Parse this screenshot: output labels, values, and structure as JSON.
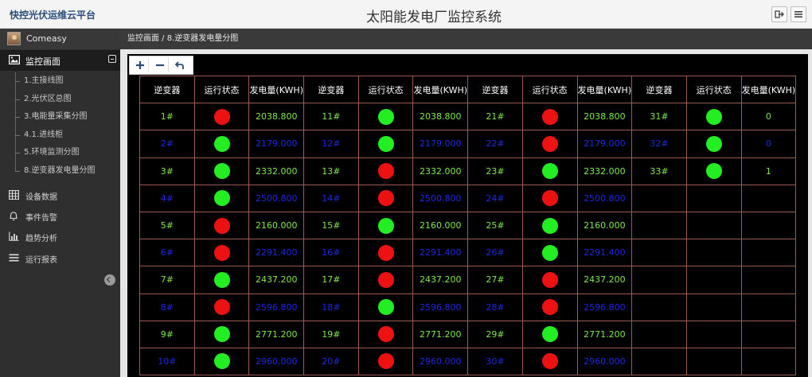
{
  "header": {
    "brand": "快控光伏运维云平台",
    "title": "太阳能发电厂监控系统"
  },
  "sidebar": {
    "user": "Comeasy",
    "section": {
      "label": "监控画面"
    },
    "sub_items": [
      "1.主接线图",
      "2.光伏区总图",
      "3.电能量采集分图",
      "4.1.进线柜",
      "5.环境监测分图",
      "8.逆变器发电量分图"
    ],
    "nav": [
      {
        "label": "设备数据",
        "icon": "table-icon"
      },
      {
        "label": "事件告警",
        "icon": "bell-icon"
      },
      {
        "label": "趋势分析",
        "icon": "bar-chart-icon"
      },
      {
        "label": "运行报表",
        "icon": "list-icon"
      }
    ]
  },
  "breadcrumb": {
    "root": "监控画面 /",
    "current": "8.逆变器发电量分图"
  },
  "colors": {
    "on": "#22ee22",
    "off": "#ee1111",
    "even_text": "#7ee84a",
    "odd_text": "#1a2ae0",
    "grid": "#9a5a4e"
  },
  "table": {
    "headers": [
      "逆变器",
      "运行状态",
      "发电量(KWH)",
      "逆变器",
      "运行状态",
      "发电量(KWH)",
      "逆变器",
      "运行状态",
      "发电量(KWH)",
      "逆变器",
      "运行状态",
      "发电量(KWH)"
    ],
    "rows": [
      [
        [
          "1#",
          "off",
          "2038.800"
        ],
        [
          "11#",
          "on",
          "2038.800"
        ],
        [
          "21#",
          "off",
          "2038.800"
        ],
        [
          "31#",
          "on",
          "0"
        ]
      ],
      [
        [
          "2#",
          "on",
          "2179.000"
        ],
        [
          "12#",
          "on",
          "2179.000"
        ],
        [
          "22#",
          "off",
          "2179.000"
        ],
        [
          "32#",
          "on",
          "0"
        ]
      ],
      [
        [
          "3#",
          "on",
          "2332.000"
        ],
        [
          "13#",
          "off",
          "2332.000"
        ],
        [
          "23#",
          "on",
          "2332.000"
        ],
        [
          "33#",
          "on",
          "1"
        ]
      ],
      [
        [
          "4#",
          "on",
          "2500.800"
        ],
        [
          "14#",
          "off",
          "2500.800"
        ],
        [
          "24#",
          "off",
          "2500.800"
        ],
        null
      ],
      [
        [
          "5#",
          "off",
          "2160.000"
        ],
        [
          "15#",
          "on",
          "2160.000"
        ],
        [
          "25#",
          "on",
          "2160.000"
        ],
        null
      ],
      [
        [
          "6#",
          "off",
          "2291.400"
        ],
        [
          "16#",
          "off",
          "2291.400"
        ],
        [
          "26#",
          "on",
          "2291.400"
        ],
        null
      ],
      [
        [
          "7#",
          "on",
          "2437.200"
        ],
        [
          "17#",
          "off",
          "2437.200"
        ],
        [
          "27#",
          "off",
          "2437.200"
        ],
        null
      ],
      [
        [
          "8#",
          "off",
          "2596.800"
        ],
        [
          "18#",
          "on",
          "2596.800"
        ],
        [
          "28#",
          "off",
          "2596.800"
        ],
        null
      ],
      [
        [
          "9#",
          "on",
          "2771.200"
        ],
        [
          "19#",
          "off",
          "2771.200"
        ],
        [
          "29#",
          "on",
          "2771.200"
        ],
        null
      ],
      [
        [
          "10#",
          "on",
          "2960.000"
        ],
        [
          "20#",
          "off",
          "2960.000"
        ],
        [
          "30#",
          "off",
          "2960.000"
        ],
        null
      ]
    ]
  }
}
